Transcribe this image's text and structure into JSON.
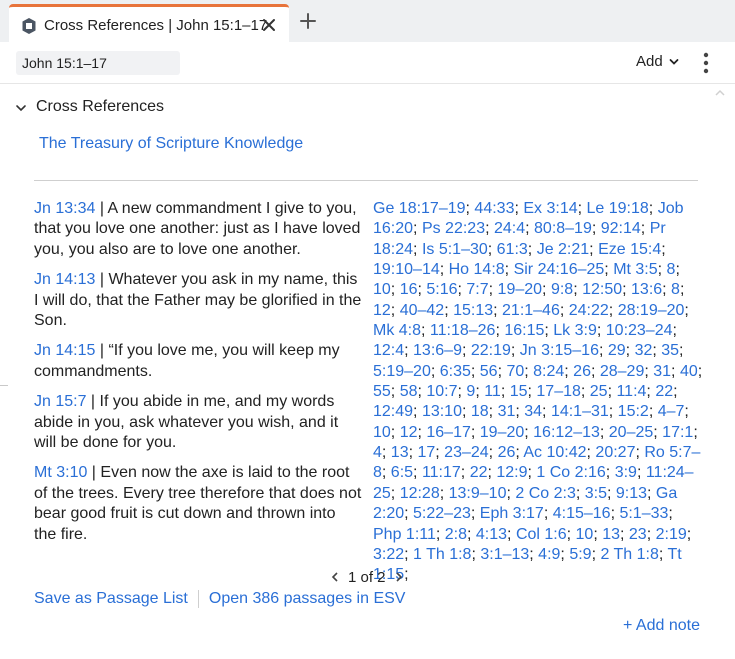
{
  "tab": {
    "title": "Cross References | John 15:1–17",
    "icon": "cross-references-icon"
  },
  "toolbar": {
    "reference": "John 15:1–17",
    "add_label": "Add"
  },
  "section": {
    "title": "Cross References"
  },
  "resource": {
    "title": "The Treasury of Scripture Knowledge"
  },
  "verses": [
    {
      "ref": "Jn 13:34",
      "text": " | A new commandment I give to you, that you love one another: just as I have loved you, you also are to love one another."
    },
    {
      "ref": "Jn 14:13",
      "text": " | Whatever you ask in my name, this I will do, that the Father may be glorified in the Son."
    },
    {
      "ref": "Jn 14:15",
      "text": " | “If you love me, you will keep my commandments."
    },
    {
      "ref": "Jn 15:7",
      "text": " | If you abide in me, and my words abide in you, ask whatever you wish, and it will be done for you."
    },
    {
      "ref": "Mt 3:10",
      "text": " | Even now the axe is laid to the root of the trees. Every tree therefore that does not bear good fruit is cut down and thrown into the fire."
    }
  ],
  "cross_refs": [
    "Ge 18:17–19",
    "44:33",
    "Ex 3:14",
    "Le 19:18",
    "Job 16:20",
    "Ps 22:23",
    "24:4",
    "80:8–19",
    "92:14",
    "Pr 18:24",
    "Is 5:1–30",
    "61:3",
    "Je 2:21",
    "Eze 15:4",
    "19:10–14",
    "Ho 14:8",
    "Sir 24:16–25",
    "Mt 3:5",
    "8",
    "10",
    "16",
    "5:16",
    "7:7",
    "19–20",
    "9:8",
    "12:50",
    "13:6",
    "8",
    "12",
    "40–42",
    "15:13",
    "21:1–46",
    "24:22",
    "28:19–20",
    "Mk 4:8",
    "11:18–26",
    "16:15",
    "Lk 3:9",
    "10:23–24",
    "12:4",
    "13:6–9",
    "22:19",
    "Jn 3:15–16",
    "29",
    "32",
    "35",
    "5:19–20",
    "6:35",
    "56",
    "70",
    "8:24",
    "26",
    "28–29",
    "31",
    "40",
    "55",
    "58",
    "10:7",
    "9",
    "11",
    "15",
    "17–18",
    "25",
    "11:4",
    "22",
    "12:49",
    "13:10",
    "18",
    "31",
    "34",
    "14:1–31",
    "15:2",
    "4–7",
    "10",
    "12",
    "16–17",
    "19–20",
    "16:12–13",
    "20–25",
    "17:1",
    "4",
    "13",
    "17",
    "23–24",
    "26",
    "Ac 10:42",
    "20:27",
    "Ro 5:7–8",
    "6:5",
    "11:17",
    "22",
    "12:9",
    "1 Co 2:16",
    "3:9",
    "11:24–25",
    "12:28",
    "13:9–10",
    "2 Co 2:3",
    "3:5",
    "9:13",
    "Ga 2:20",
    "5:22–23",
    "Eph 3:17",
    "4:15–16",
    "5:1–33",
    "Php 1:11",
    "2:8",
    "4:13",
    "Col 1:6",
    "10",
    "13",
    "23",
    "2:19",
    "3:22",
    "1 Th 1:8",
    "3:1–13",
    "4:9",
    "5:9",
    "2 Th 1:8",
    "Tt 1:15"
  ],
  "pager": {
    "text": "1 of 2"
  },
  "links": {
    "save": "Save as Passage List",
    "open": "Open 386 passages in ESV",
    "add_note": "+ Add note"
  },
  "colors": {
    "accent": "#2a6fd6",
    "tab_indicator": "#e8743b"
  }
}
